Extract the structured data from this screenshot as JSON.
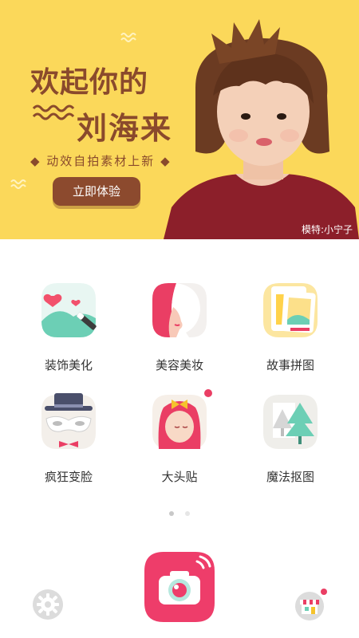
{
  "banner": {
    "title_line1": "欢起你的",
    "title_line2": "刘海来",
    "subtitle": "◆ 动效自拍素材上新 ◆",
    "button_label": "立即体验",
    "model_credit": "模特:小宁子",
    "bg_color": "#fbd85a",
    "accent_color": "#8a4a2c"
  },
  "features": [
    {
      "label": "装饰美化",
      "icon": "landscape-wand-icon"
    },
    {
      "label": "美容美妆",
      "icon": "woman-profile-icon"
    },
    {
      "label": "故事拼图",
      "icon": "photo-collage-icon"
    },
    {
      "label": "疯狂变脸",
      "icon": "mask-hat-icon"
    },
    {
      "label": "大头贴",
      "icon": "cartoon-girl-icon"
    },
    {
      "label": "魔法抠图",
      "icon": "trees-icon"
    }
  ],
  "pager": {
    "active_page": 1,
    "total_pages": 2,
    "active_color": "#c8c8c8",
    "inactive_color": "#e6e6e6"
  },
  "bottom": {
    "camera_icon": "camera-icon",
    "settings_icon": "gear-icon",
    "store_icon": "store-icon",
    "camera_color": "#ee3d6a"
  }
}
